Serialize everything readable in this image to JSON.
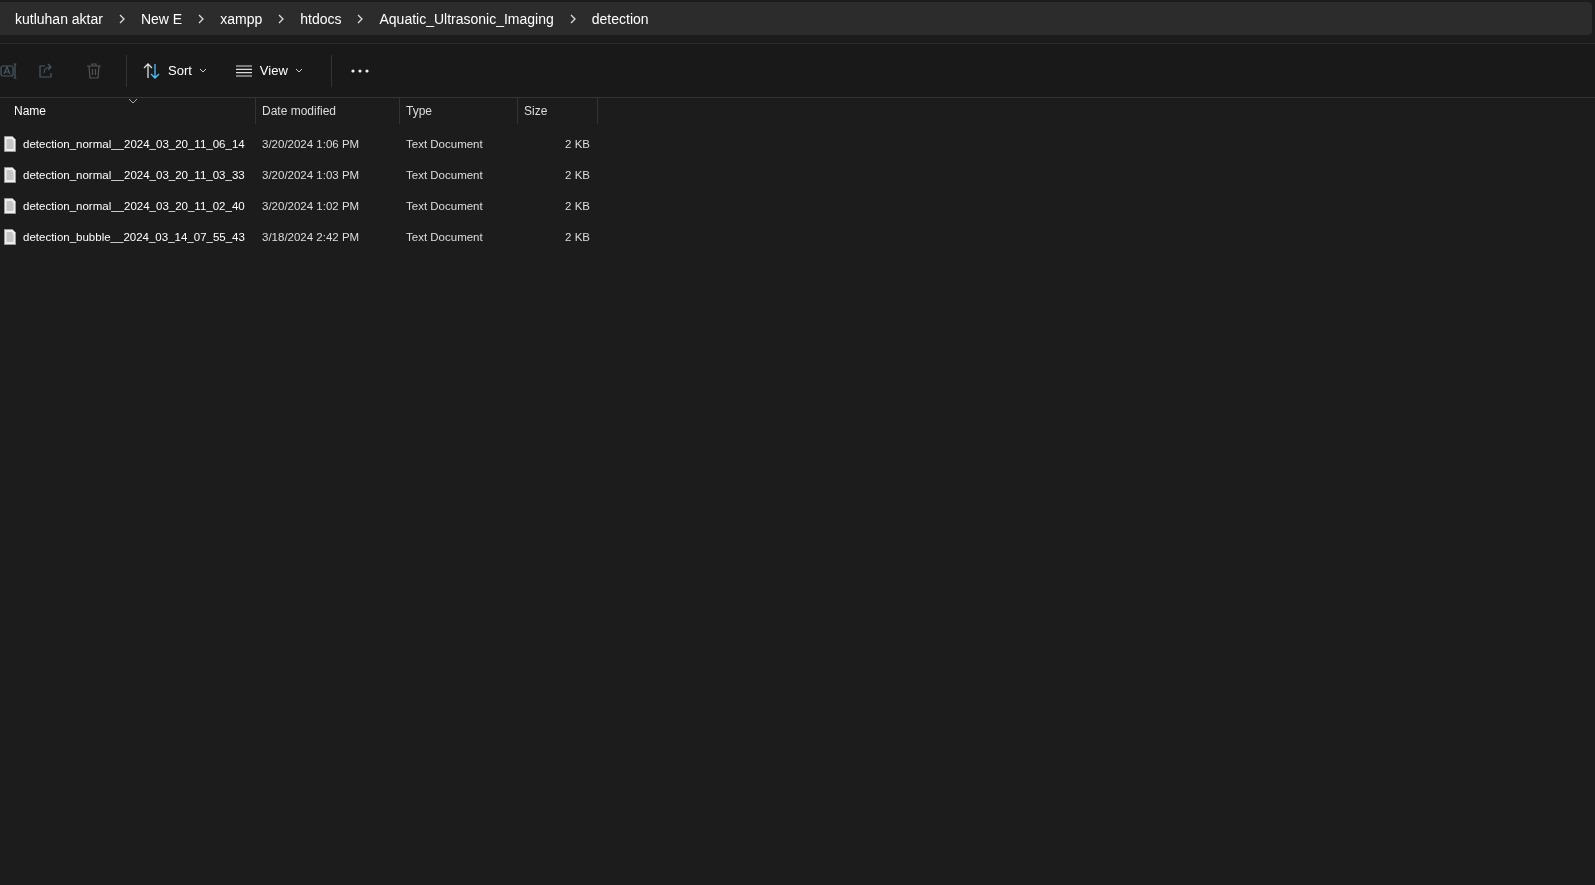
{
  "breadcrumb": [
    "kutluhan aktar",
    "New E",
    "xampp",
    "htdocs",
    "Aquatic_Ultrasonic_Imaging",
    "detection"
  ],
  "toolbar": {
    "icon_buttons": [
      {
        "kind": "rename",
        "disabled": true
      },
      {
        "kind": "share",
        "disabled": true
      },
      {
        "kind": "delete",
        "disabled": true
      }
    ],
    "menus": [
      {
        "kind": "sort",
        "label": "Sort"
      },
      {
        "kind": "view",
        "label": "View"
      }
    ]
  },
  "table": {
    "columns": [
      {
        "label": "Name",
        "sorted": true
      },
      {
        "label": "Date modified",
        "sorted": false
      },
      {
        "label": "Type",
        "sorted": false
      },
      {
        "label": "Size",
        "sorted": false
      }
    ],
    "rows": [
      {
        "name": "detection_normal__2024_03_20_11_06_14",
        "date": "3/20/2024 1:06 PM",
        "type": "Text Document",
        "size": "2 KB"
      },
      {
        "name": "detection_normal__2024_03_20_11_03_33",
        "date": "3/20/2024 1:03 PM",
        "type": "Text Document",
        "size": "2 KB"
      },
      {
        "name": "detection_normal__2024_03_20_11_02_40",
        "date": "3/20/2024 1:02 PM",
        "type": "Text Document",
        "size": "2 KB"
      },
      {
        "name": "detection_bubble__2024_03_14_07_55_43",
        "date": "3/18/2024 2:42 PM",
        "type": "Text Document",
        "size": "2 KB"
      }
    ]
  }
}
